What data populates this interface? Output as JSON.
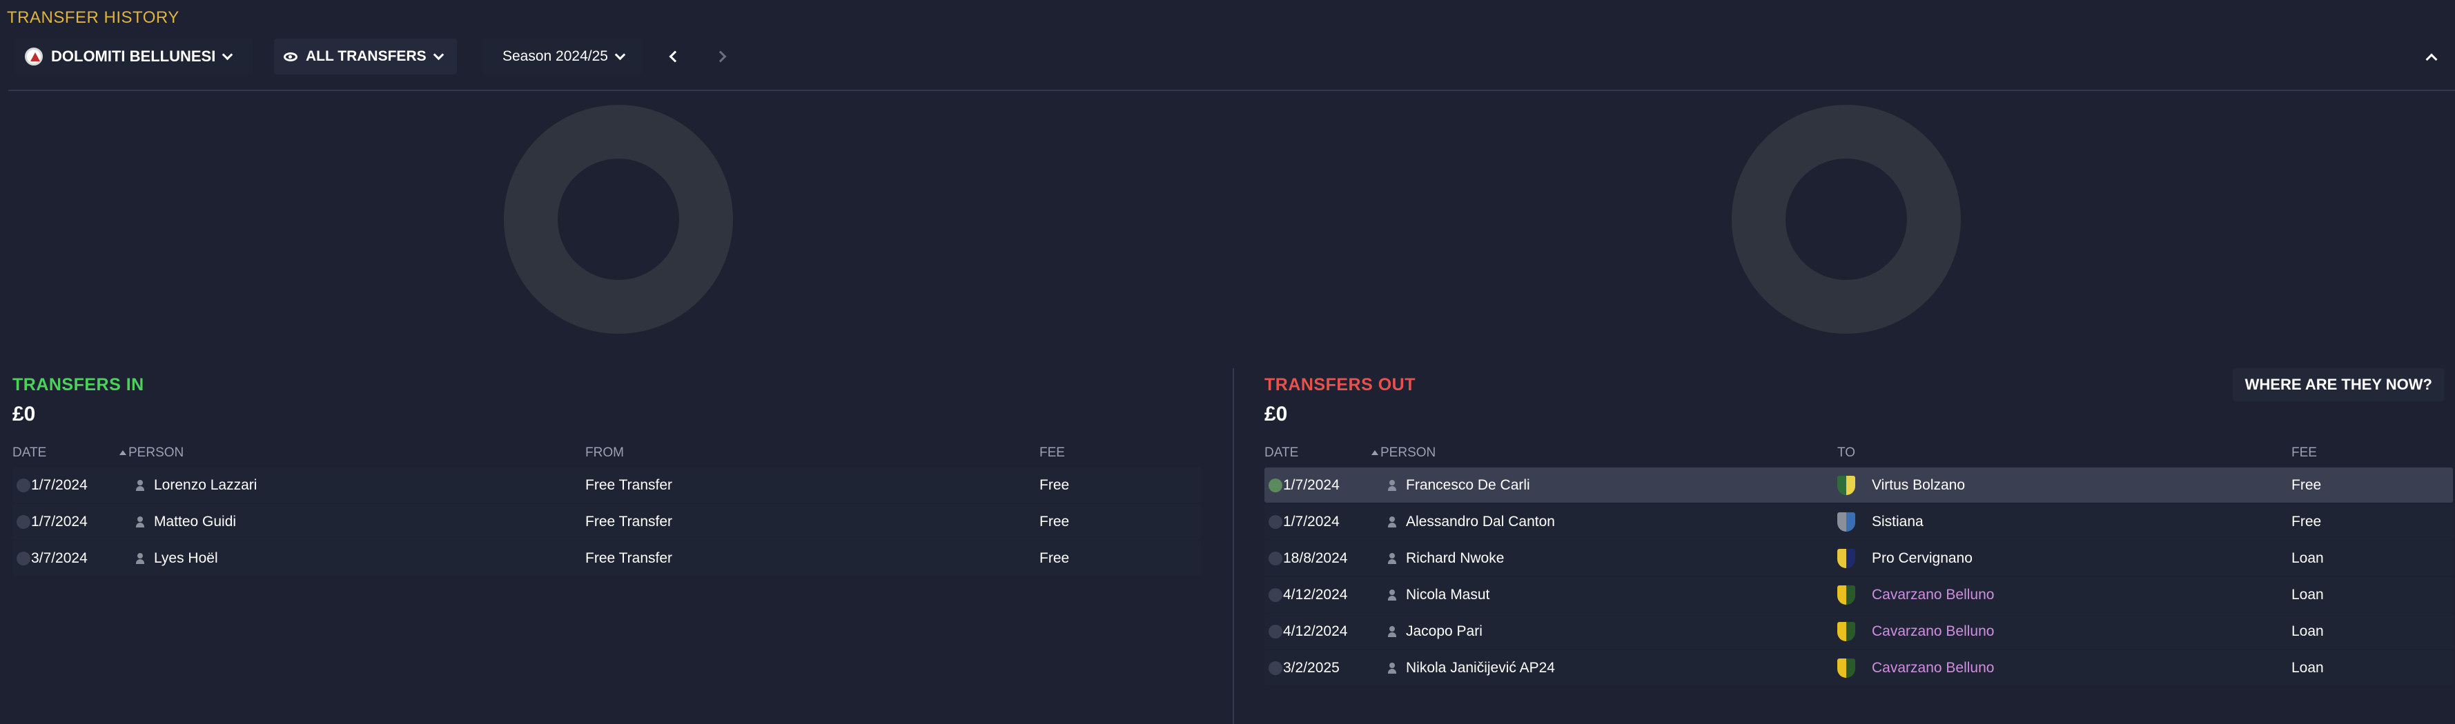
{
  "page": {
    "title": "TRANSFER HISTORY"
  },
  "toolbar": {
    "club": "DOLOMITI BELLUNESI",
    "filter": "ALL TRANSFERS",
    "season": "Season 2024/25"
  },
  "transfers_in": {
    "title": "TRANSFERS IN",
    "total": "£0",
    "columns": {
      "date": "DATE",
      "person": "PERSON",
      "from": "FROM",
      "fee": "FEE"
    },
    "rows": [
      {
        "date": "1/7/2024",
        "person": "Lorenzo Lazzari",
        "from": "Free Transfer",
        "fee": "Free"
      },
      {
        "date": "1/7/2024",
        "person": "Matteo Guidi",
        "from": "Free Transfer",
        "fee": "Free"
      },
      {
        "date": "3/7/2024",
        "person": "Lyes Hoël",
        "from": "Free Transfer",
        "fee": "Free"
      }
    ]
  },
  "transfers_out": {
    "title": "TRANSFERS OUT",
    "total": "£0",
    "where_button": "WHERE ARE THEY NOW?",
    "columns": {
      "date": "DATE",
      "person": "PERSON",
      "to": "TO",
      "fee": "FEE"
    },
    "rows": [
      {
        "date": "1/7/2024",
        "person": "Francesco De Carli",
        "to": "Virtus Bolzano",
        "fee": "Free",
        "badge_colors": [
          "#2f6d3a",
          "#e8d34a"
        ]
      },
      {
        "date": "1/7/2024",
        "person": "Alessandro Dal Canton",
        "to": "Sistiana",
        "fee": "Free",
        "badge_colors": [
          "#8a8f9c",
          "#3b6fb5"
        ]
      },
      {
        "date": "18/8/2024",
        "person": "Richard Nwoke",
        "to": "Pro Cervignano",
        "fee": "Loan",
        "badge_colors": [
          "#e8c83a",
          "#1e2a6a"
        ]
      },
      {
        "date": "4/12/2024",
        "person": "Nicola Masut",
        "to": "Cavarzano Belluno",
        "fee": "Loan",
        "badge_colors": [
          "#e8c020",
          "#2a5a2a"
        ]
      },
      {
        "date": "4/12/2024",
        "person": "Jacopo Pari",
        "to": "Cavarzano Belluno",
        "fee": "Loan",
        "badge_colors": [
          "#e8c020",
          "#2a5a2a"
        ]
      },
      {
        "date": "3/2/2025",
        "person": "Nikola Janičijević AP24",
        "to": "Cavarzano Belluno",
        "fee": "Loan",
        "badge_colors": [
          "#e8c020",
          "#2a5a2a"
        ]
      }
    ]
  },
  "colors": {
    "in_accent": "#4bd25a",
    "out_accent": "#e8524d",
    "title_accent": "#e0b43c",
    "link": "#d08ee0"
  }
}
